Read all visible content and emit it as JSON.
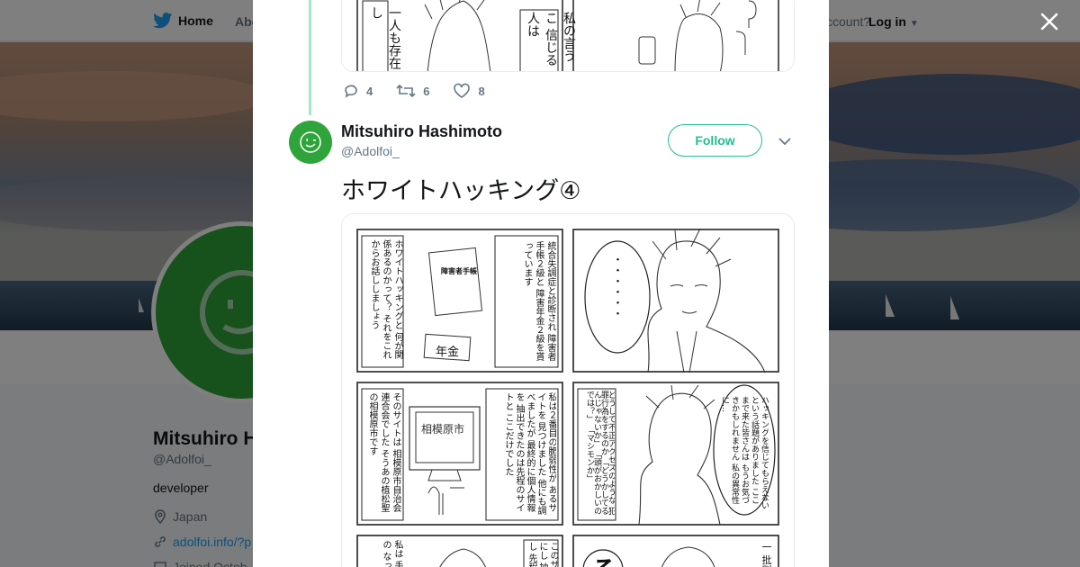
{
  "colors": {
    "brand_blue": "#1da1f2",
    "follow_green": "#1fbf8f",
    "avatar_green": "#2fa43b",
    "thread_line": "#a3e6c8"
  },
  "topnav": {
    "home_label": "Home",
    "about_label": "Abo",
    "account_text": "ccount?",
    "login_label": "Log in"
  },
  "profile": {
    "name": "Mitsuhiro Ha",
    "handle": "@Adolfoi_",
    "bio": "developer",
    "location": "Japan",
    "url": "adolfoi.info/?p",
    "joined": "Joined Octob"
  },
  "previous_tweet": {
    "reply_count": "4",
    "retweet_count": "6",
    "like_count": "8"
  },
  "tweet": {
    "author_name": "Mitsuhiro Hashimoto",
    "author_handle": "@Adolfoi_",
    "follow_label": "Follow",
    "text": "ホワイトハッキング④"
  },
  "comic": {
    "prev_panel_left": "一人も存在し",
    "prev_panel_mid": "私の言うこ 信じる人は",
    "p1_narration": "ホワイトハッキングと 何が関係あるのかって？ それをこれからお話ししましょう",
    "p1_card": "障害者手帳",
    "p1_pension": "年金",
    "p1_caption": "統合失調症と診断され 障害者手帳２級と 障害年金２級を貰っています",
    "p2_bubble": "・・・・・・",
    "p3_caption": "私は２番目の脆弱性が あるサイトを 見つけました 他にも調べましたが 最終的に個人情報を 抽出できたのは先程のサイトと ここだけでした",
    "p3_screen": "相模原市",
    "p3_narration": "そのサイトは 相模原市自治会連合会でした そうあの植松聖の相模原市です",
    "p4_narration": "どうして不正アクセスのような 犯罪行為をするのか 「どうかしてるんじゃないか」 「頭がおかしいのでは？」 「マシモンか」",
    "p4_bubble": "ハッキングを信じてもらえない という話題がありました ここまで来た皆さんは もうお気づきかもしれません 私の異常性に…",
    "p5_text": "私は 手法の なった",
    "p5_caption": "このサ 手にし 抽出し 先程の",
    "p6_letter": "そ",
    "p6_side": "一 批判"
  }
}
